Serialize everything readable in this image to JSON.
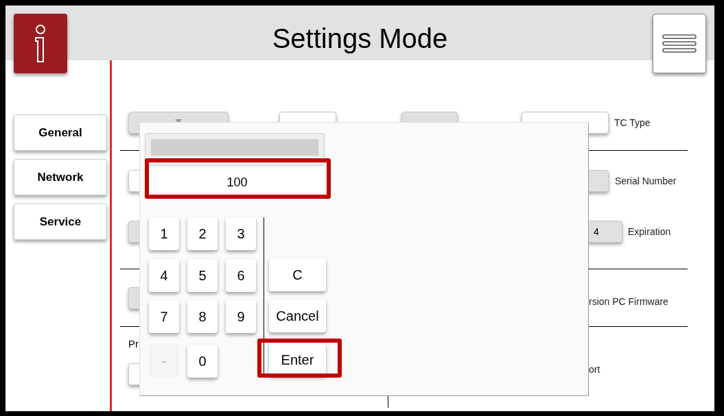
{
  "header": {
    "title": "Settings Mode"
  },
  "nav": [
    {
      "label": "General"
    },
    {
      "label": "Network"
    },
    {
      "label": "Service"
    }
  ],
  "settings": {
    "tc_type": {
      "label": "TC Type"
    },
    "serial_number": {
      "label": "Serial Number"
    },
    "expiration": {
      "value": "4",
      "label": "Expiration"
    },
    "firmware": {
      "label": "rsion PC Firmware"
    },
    "section_heading": "Pr",
    "support": {
      "label": "ort"
    }
  },
  "keypad": {
    "display": {
      "value": "100",
      "highlighted": true
    },
    "keys": [
      {
        "label": "1",
        "disabled": false
      },
      {
        "label": "2",
        "disabled": false
      },
      {
        "label": "3",
        "disabled": false
      },
      {
        "label": "4",
        "disabled": false
      },
      {
        "label": "5",
        "disabled": false
      },
      {
        "label": "6",
        "disabled": false
      },
      {
        "label": "7",
        "disabled": false
      },
      {
        "label": "8",
        "disabled": false
      },
      {
        "label": "9",
        "disabled": false
      },
      {
        "label": "-",
        "disabled": true
      },
      {
        "label": "0",
        "disabled": false
      }
    ],
    "actions": [
      {
        "label": "C",
        "highlighted": false
      },
      {
        "label": "Cancel",
        "highlighted": false
      },
      {
        "label": "Enter",
        "highlighted": true
      }
    ]
  }
}
